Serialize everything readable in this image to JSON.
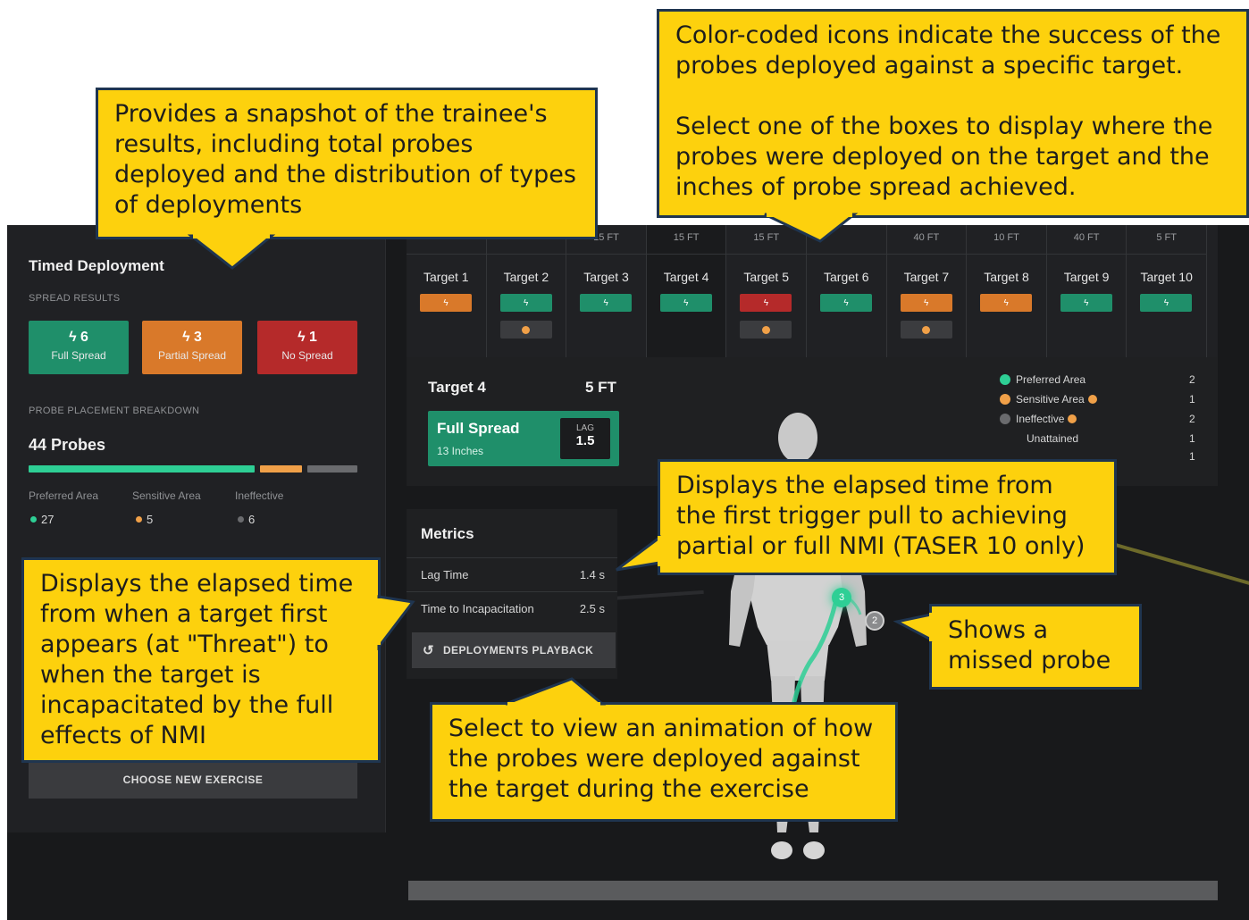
{
  "left_panel": {
    "title": "Timed Deployment",
    "spread_results_label": "SPREAD RESULTS",
    "spread": [
      {
        "value": "6",
        "label": "Full Spread",
        "color": "#1f8f6a"
      },
      {
        "value": "3",
        "label": "Partial Spread",
        "color": "#d9792a"
      },
      {
        "value": "1",
        "label": "No Spread",
        "color": "#b52a2a"
      }
    ],
    "breakdown_label": "PROBE PLACEMENT BREAKDOWN",
    "probes_total": "44 Probes",
    "areas": [
      {
        "label": "Preferred Area",
        "value": "27",
        "color": "#2ecf95",
        "fraction": 0.6136
      },
      {
        "label": "Sensitive Area",
        "value": "5",
        "color": "#f0a048",
        "fraction": 0.1136
      },
      {
        "label": "Ineffective",
        "value": "6",
        "color": "#6a6b6e",
        "fraction": 0.1364
      }
    ],
    "choose_button": "CHOOSE NEW EXERCISE"
  },
  "targets": [
    {
      "name": "Target 1",
      "distance": "",
      "status": "partial",
      "sub": false
    },
    {
      "name": "Target 2",
      "distance": "",
      "status": "full",
      "sub": true
    },
    {
      "name": "Target 3",
      "distance": "15 FT",
      "status": "full",
      "sub": false
    },
    {
      "name": "Target 4",
      "distance": "15 FT",
      "status": "full",
      "sub": false,
      "selected": true
    },
    {
      "name": "Target 5",
      "distance": "15 FT",
      "status": "none",
      "sub": true
    },
    {
      "name": "Target 6",
      "distance": "",
      "status": "full",
      "sub": false
    },
    {
      "name": "Target 7",
      "distance": "40 FT",
      "status": "partial",
      "sub": true
    },
    {
      "name": "Target 8",
      "distance": "10 FT",
      "status": "partial",
      "sub": false
    },
    {
      "name": "Target 9",
      "distance": "40 FT",
      "status": "full",
      "sub": false
    },
    {
      "name": "Target 10",
      "distance": "5 FT",
      "status": "full",
      "sub": false
    }
  ],
  "status_colors": {
    "full": "#1f8f6a",
    "partial": "#d9792a",
    "none": "#b52a2a"
  },
  "detail": {
    "target": "Target 4",
    "distance": "5 FT",
    "spread_label": "Full Spread",
    "spread_inches": "13 Inches",
    "lag_label": "LAG",
    "lag_value": "1.5",
    "areas": [
      {
        "label": "Preferred Area",
        "count": "2",
        "color": "#2ecf95",
        "sensitive": false
      },
      {
        "label": "Sensitive Area",
        "count": "1",
        "color": "#f0a048",
        "sensitive": true
      },
      {
        "label": "Ineffective",
        "count": "2",
        "color": "#6a6b6e",
        "sensitive": true
      },
      {
        "label": "Unattained",
        "count": "1",
        "color": "",
        "sensitive": false
      },
      {
        "label": "",
        "count": "1",
        "color": "",
        "sensitive": false
      }
    ]
  },
  "metrics": {
    "title": "Metrics",
    "lag_time_label": "Lag Time",
    "lag_time_value": "1.4 s",
    "incap_label": "Time to Incapacitation",
    "incap_value": "2.5 s",
    "playback_button": "DEPLOYMENTS PLAYBACK"
  },
  "figure": {
    "probe_hit": "3",
    "probe_miss": "2"
  },
  "callouts": {
    "snapshot": [
      "Provides a snapshot of the trainee's",
      "results, including total probes",
      "deployed and the distribution of types",
      "of deployments"
    ],
    "color_coded": [
      "Color-coded icons indicate the success of the",
      "probes deployed against a specific target.",
      "",
      "Select one of the boxes to display where the",
      "probes were deployed on the target and the",
      "inches of probe spread achieved."
    ],
    "lag_time": [
      "Displays the elapsed time from",
      "the first trigger pull to achieving",
      "partial or full NMI (TASER 10 only)"
    ],
    "incap": [
      "Displays the elapsed time",
      "from when a target first",
      "appears (at \"Threat\") to",
      "when the target is",
      "incapacitated by the full",
      "effects of NMI"
    ],
    "missed": [
      "Shows a",
      "missed probe"
    ],
    "playback": [
      "Select to view an animation of how",
      "the probes were deployed against",
      "the target during the exercise"
    ]
  }
}
